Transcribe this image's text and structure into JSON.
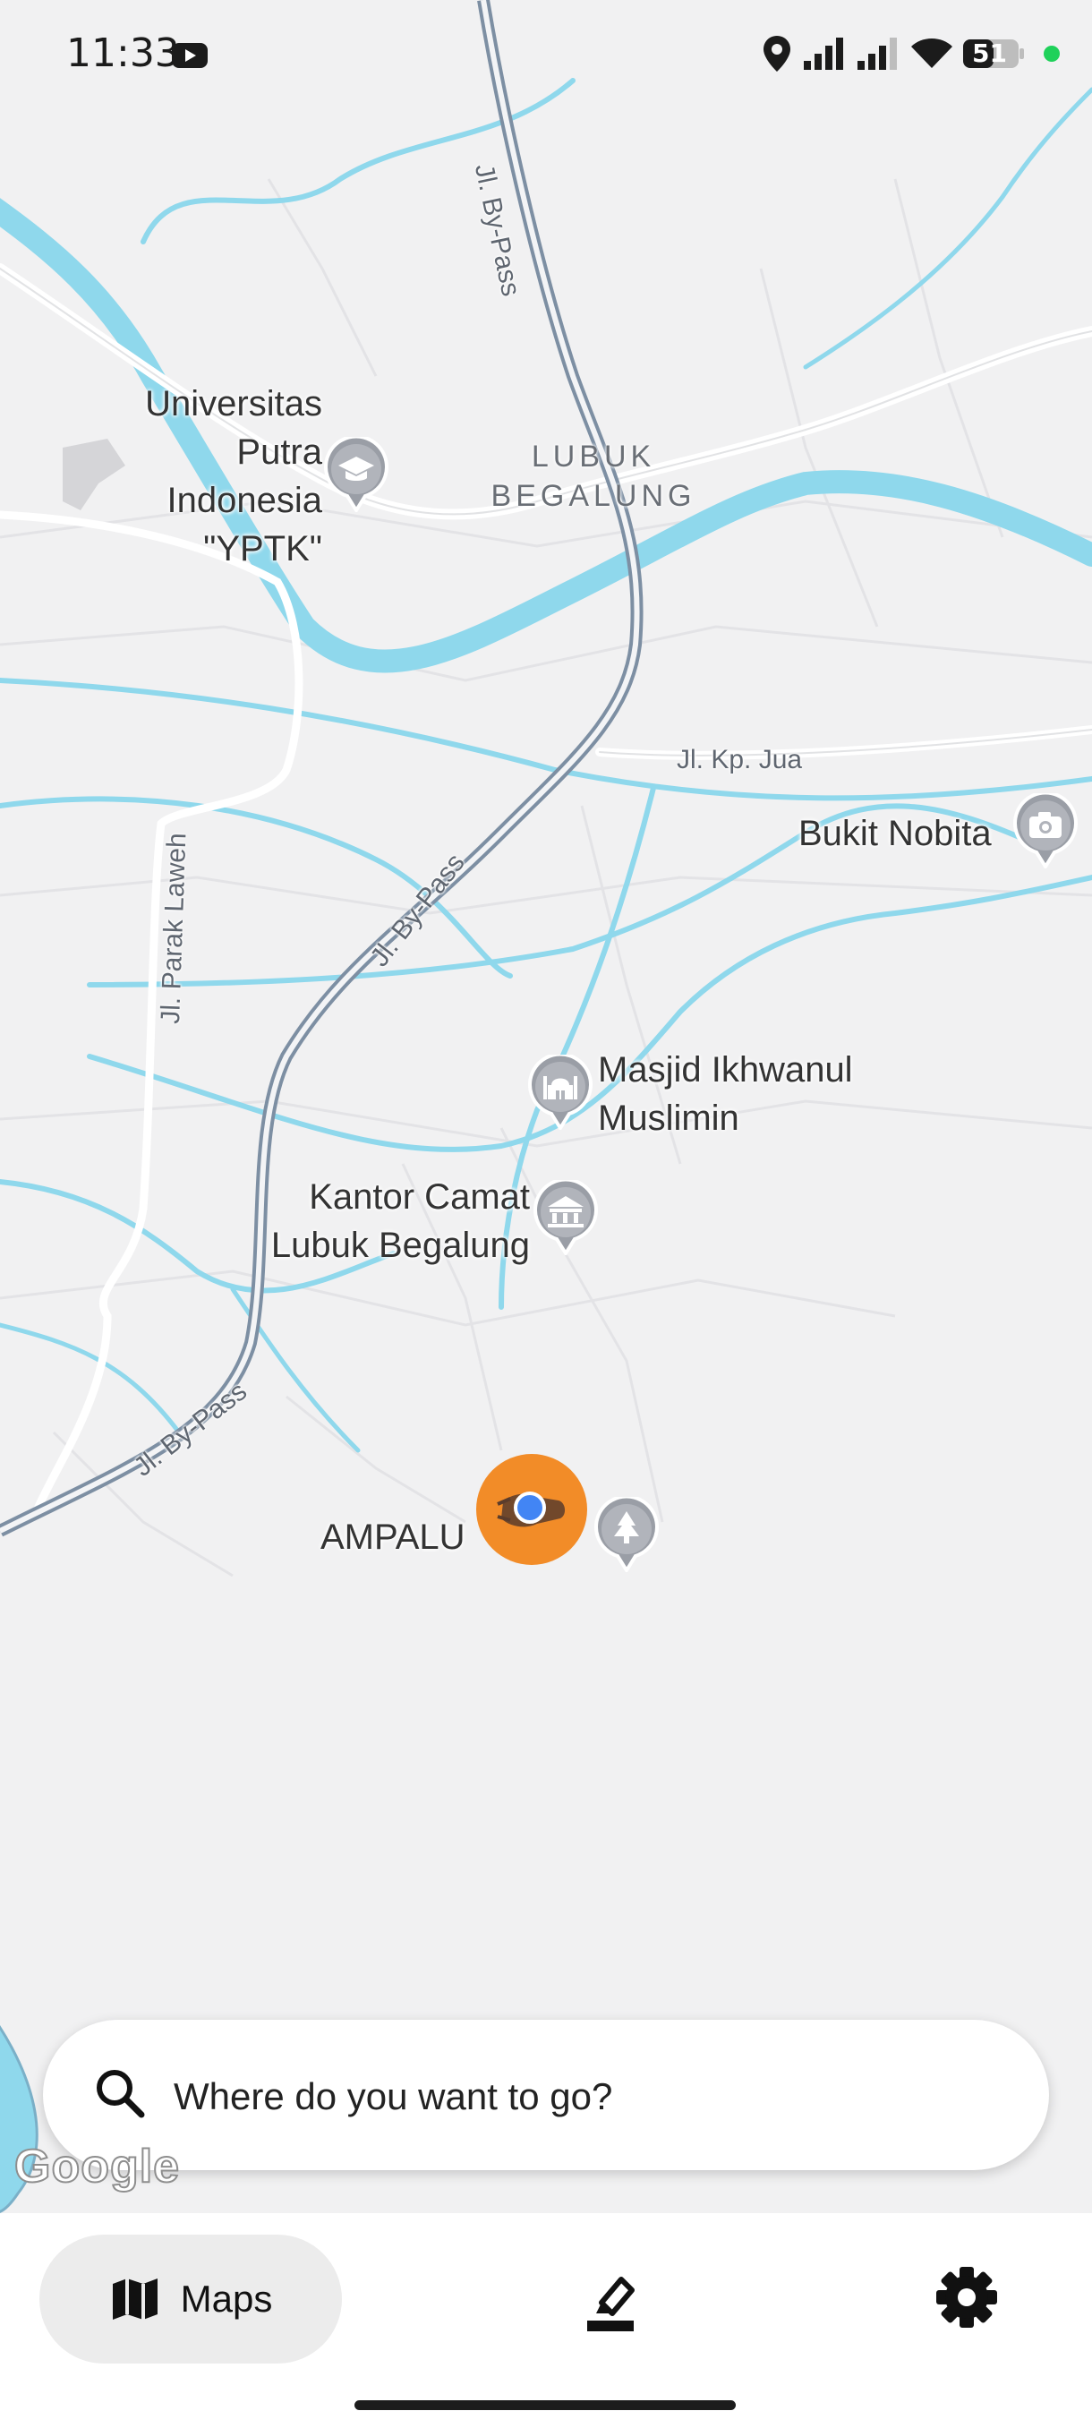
{
  "status_bar": {
    "time": "11:33",
    "battery": "51"
  },
  "map": {
    "places": {
      "universitas": [
        "Universitas",
        "Putra",
        "Indonesia",
        "\"YPTK\""
      ],
      "lubuk_begalung": [
        "LUBUK",
        "BEGALUNG"
      ],
      "bukit_nobita": "Bukit Nobita",
      "masjid": [
        "Masjid Ikhwanul",
        "Muslimin"
      ],
      "kantor_camat": [
        "Kantor Camat",
        "Lubuk Begalung"
      ],
      "ampalu": "AMPALU"
    },
    "roads": {
      "bypass_top": "Jl. By-Pass",
      "bypass_mid": "Jl. By-Pass",
      "bypass_low": "Jl. By-Pass",
      "kp_jua": "Jl. Kp. Jua",
      "parak_laweh": "Jl. Parak Laweh"
    },
    "attribution": "Google"
  },
  "search": {
    "placeholder": "Where do you want to go?"
  },
  "nav": {
    "maps_label": "Maps"
  },
  "icons": {
    "location": "location-icon",
    "signal": "signal-icon",
    "wifi": "wifi-icon",
    "battery": "battery-icon",
    "youtube": "youtube-icon",
    "search": "search-icon",
    "map": "map-icon",
    "draw": "draw-icon",
    "settings": "gear-icon"
  },
  "colors": {
    "accent": "#f28c28",
    "user_dot": "#4285f4",
    "water": "#8fd8ec"
  }
}
